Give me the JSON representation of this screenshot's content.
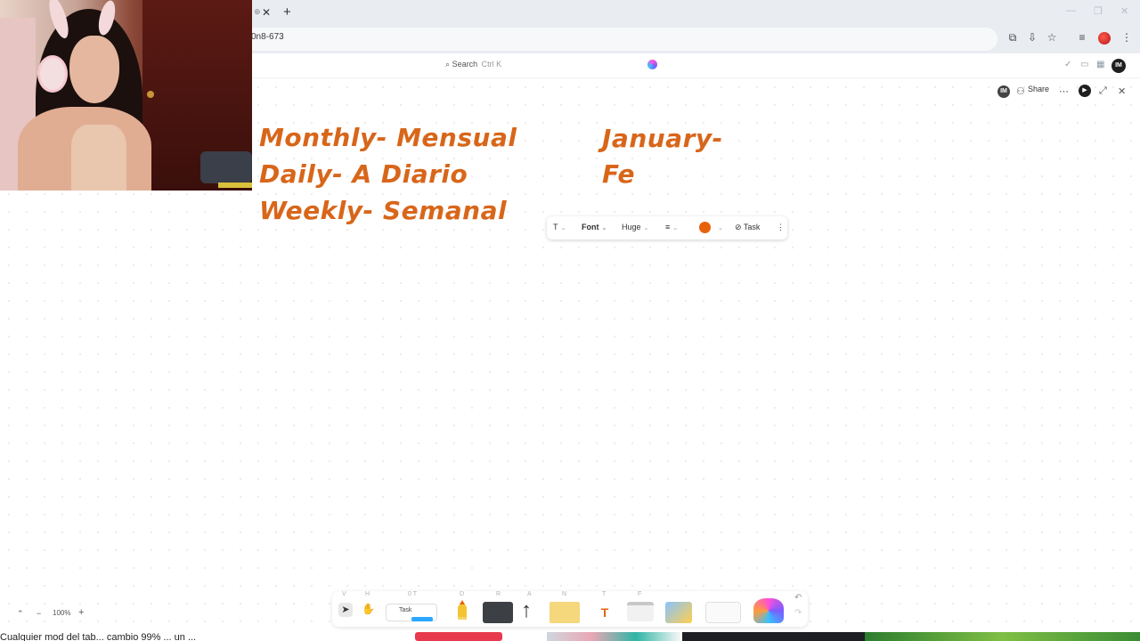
{
  "browser": {
    "url_fragment": "0n8-673",
    "tab_close_glyph": "✕",
    "new_tab_glyph": "+",
    "profile_initials": "IM"
  },
  "app": {
    "search_label": "Search",
    "search_shortcut": "Ctrl K",
    "share_label": "Share",
    "user_initials": "IM"
  },
  "canvas": {
    "text_block_left": [
      "Monthly- Mensual",
      "Daily- A Diario",
      "Weekly- Semanal"
    ],
    "text_block_right": [
      "January-",
      "Fe"
    ],
    "text_color": "#d8661a"
  },
  "text_toolbar": {
    "type_glyph": "T",
    "font_label": "Font",
    "size_label": "Huge",
    "align_glyph": "≡",
    "color": "#e8620c",
    "task_label": "Task",
    "more_glyph": "⋮"
  },
  "zoom": {
    "value": "100%",
    "minus": "−",
    "plus": "+"
  },
  "bottom_toolbar": {
    "keys": [
      "V",
      "H",
      "0 T",
      "D",
      "R",
      "A",
      "N",
      "T",
      "F"
    ],
    "task_label": "Task",
    "text_tool_glyph": "T"
  },
  "taskbar": {
    "text": "Cualquier mod del tab... cambio 99% ... un ..."
  },
  "icons": [
    "search-icon",
    "sparkle-icon",
    "share-icon",
    "more-icon",
    "expand-icon",
    "close-icon",
    "pencil-icon",
    "arrow-icon",
    "undo-icon",
    "redo-icon"
  ]
}
